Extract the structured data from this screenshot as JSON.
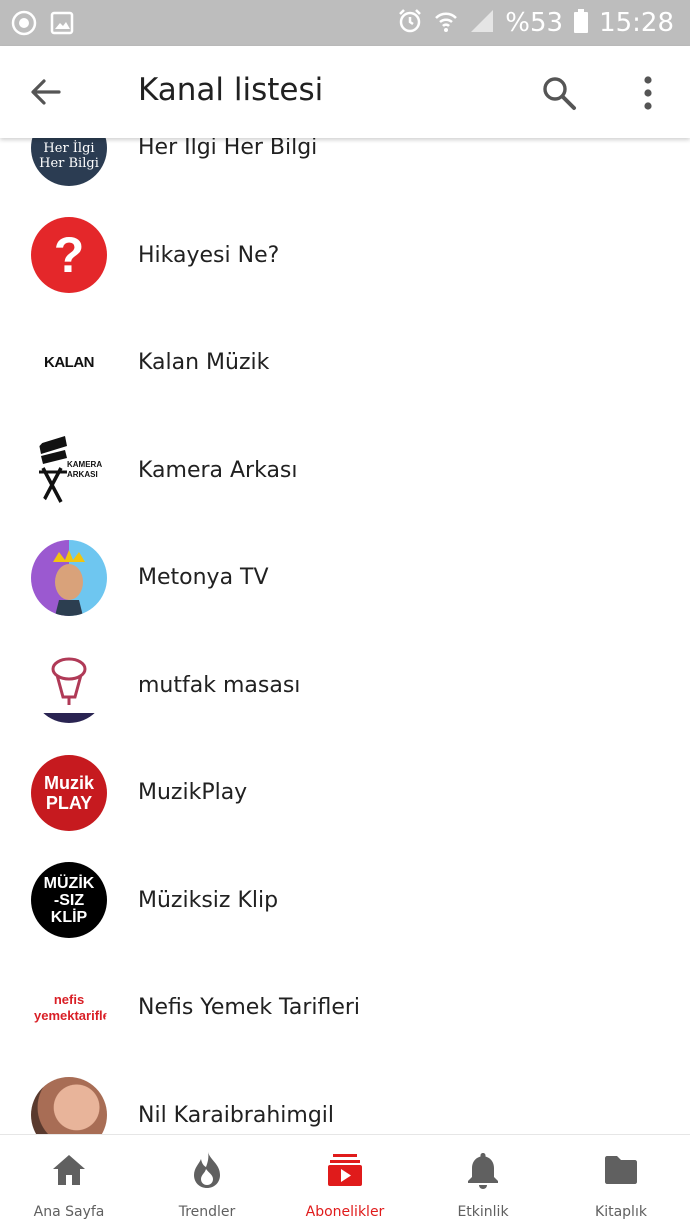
{
  "status": {
    "battery": "%53",
    "time": "15:28"
  },
  "header": {
    "title": "Kanal listesi"
  },
  "channels": [
    {
      "name": "Her İlgi Her Bilgi",
      "avatar_text": "Her İlgi Her Bilgi"
    },
    {
      "name": "Hikayesi Ne?",
      "avatar_text": "?"
    },
    {
      "name": "Kalan Müzik",
      "avatar_text": "KALAN"
    },
    {
      "name": "Kamera Arkası",
      "avatar_text": "KAMERA ARKASI"
    },
    {
      "name": "Metonya TV"
    },
    {
      "name": "mutfak masası"
    },
    {
      "name": "MuzikPlay",
      "avatar_text": "Muzik PLAY"
    },
    {
      "name": "Müziksiz Klip",
      "avatar_text": "MÜZİK -SIZ KLİP"
    },
    {
      "name": "Nefis Yemek Tarifleri",
      "avatar_text": "nefis yemektarifleri"
    },
    {
      "name": "Nil Karaibrahimgil"
    }
  ],
  "nav": [
    {
      "label": "Ana Sayfa",
      "icon": "home-icon"
    },
    {
      "label": "Trendler",
      "icon": "flame-icon"
    },
    {
      "label": "Abonelikler",
      "icon": "subscriptions-icon"
    },
    {
      "label": "Etkinlik",
      "icon": "bell-icon"
    },
    {
      "label": "Kitaplık",
      "icon": "folder-icon"
    }
  ],
  "colors": {
    "accent": "#e01b1b",
    "status_bar": "#bdbdbd",
    "text": "#212121"
  }
}
